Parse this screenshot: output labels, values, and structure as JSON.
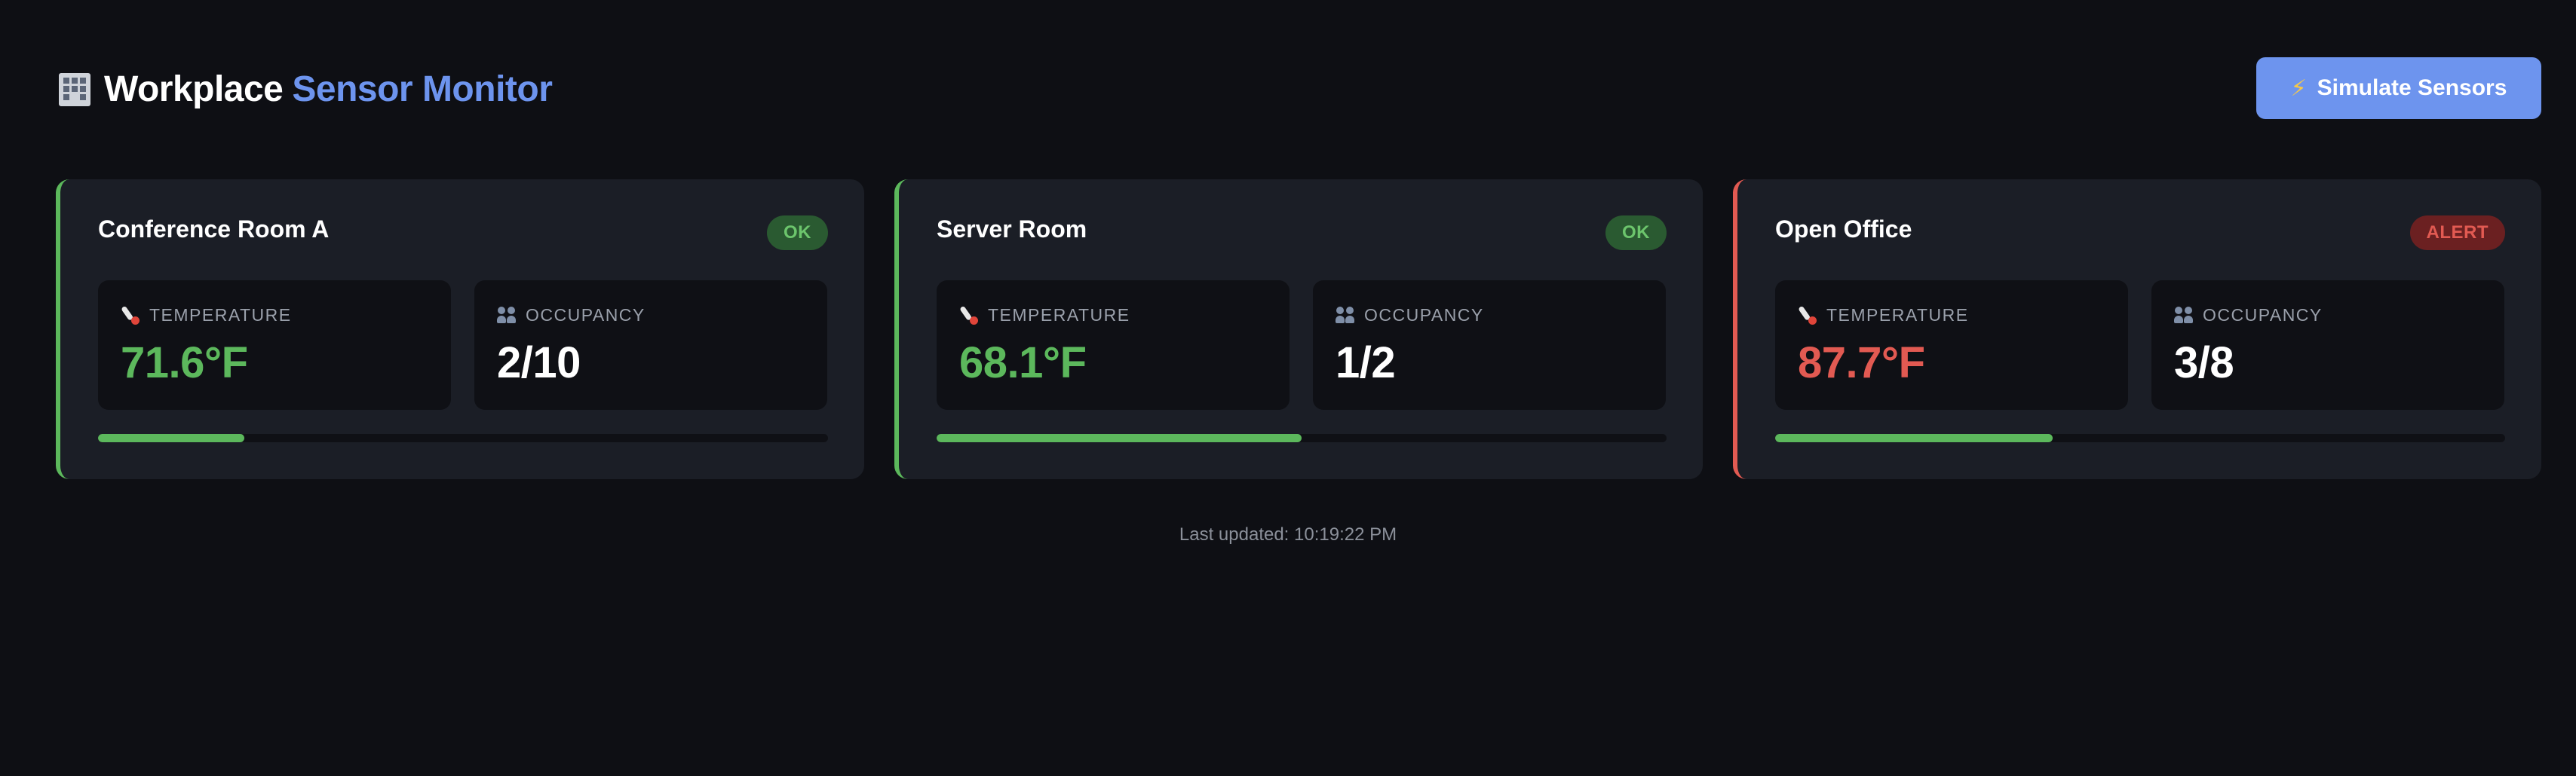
{
  "header": {
    "title_main": "Workplace",
    "title_accent": "Sensor Monitor",
    "title_icon": "office-building-icon",
    "simulate_button": {
      "icon": "lightning-bolt-icon",
      "label": "Simulate Sensors"
    }
  },
  "metric_labels": {
    "temperature": "TEMPERATURE",
    "occupancy": "OCCUPANCY"
  },
  "rooms": [
    {
      "name": "Conference Room A",
      "status": "OK",
      "temperature": "71.6°F",
      "occupancy": "2/10",
      "occupancy_fraction": 0.2
    },
    {
      "name": "Server Room",
      "status": "OK",
      "temperature": "68.1°F",
      "occupancy": "1/2",
      "occupancy_fraction": 0.5
    },
    {
      "name": "Open Office",
      "status": "ALERT",
      "temperature": "87.7°F",
      "occupancy": "3/8",
      "occupancy_fraction": 0.38
    }
  ],
  "footer": {
    "last_updated": "Last updated: 10:19:22 PM"
  },
  "colors": {
    "background": "#0e0f14",
    "card": "#1b1e26",
    "accent": "#6d94ee",
    "ok": "#5cb85c",
    "alert": "#e25a52"
  }
}
